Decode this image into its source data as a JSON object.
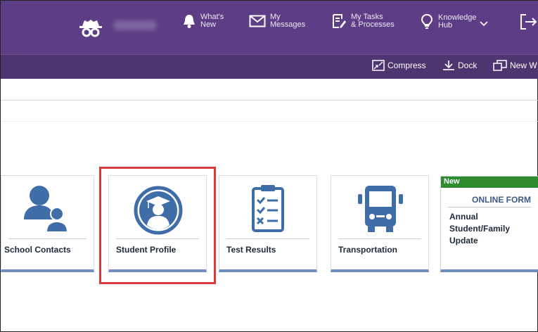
{
  "header": {
    "user_name": "",
    "nav": [
      {
        "label": "What's\nNew",
        "icon": "bell-icon"
      },
      {
        "label": "My\nMessages",
        "icon": "envelope-icon"
      },
      {
        "label": "My Tasks\n& Processes",
        "icon": "tasks-icon"
      },
      {
        "label": "Knowledge\nHub",
        "icon": "lightbulb-icon"
      }
    ]
  },
  "toolbar": {
    "compress": "Compress",
    "dock": "Dock",
    "new_window": "New W"
  },
  "tiles": [
    {
      "label": "School Contacts",
      "icon": "contacts-icon"
    },
    {
      "label": "Student Profile",
      "icon": "graduate-icon"
    },
    {
      "label": "Test Results",
      "icon": "checklist-icon"
    },
    {
      "label": "Transportation",
      "icon": "bus-icon"
    }
  ],
  "online_form": {
    "badge": "New",
    "heading": "ONLINE FORM",
    "lines": [
      "Annual",
      "Student/Family",
      "Update"
    ]
  },
  "colors": {
    "header_bg": "#5d3e86",
    "subbar_bg": "#4f356f",
    "tile_accent": "#6d8fc0",
    "icon_blue": "#3f6da8",
    "highlight": "#d83b3b",
    "new_badge": "#2e8b2e"
  }
}
